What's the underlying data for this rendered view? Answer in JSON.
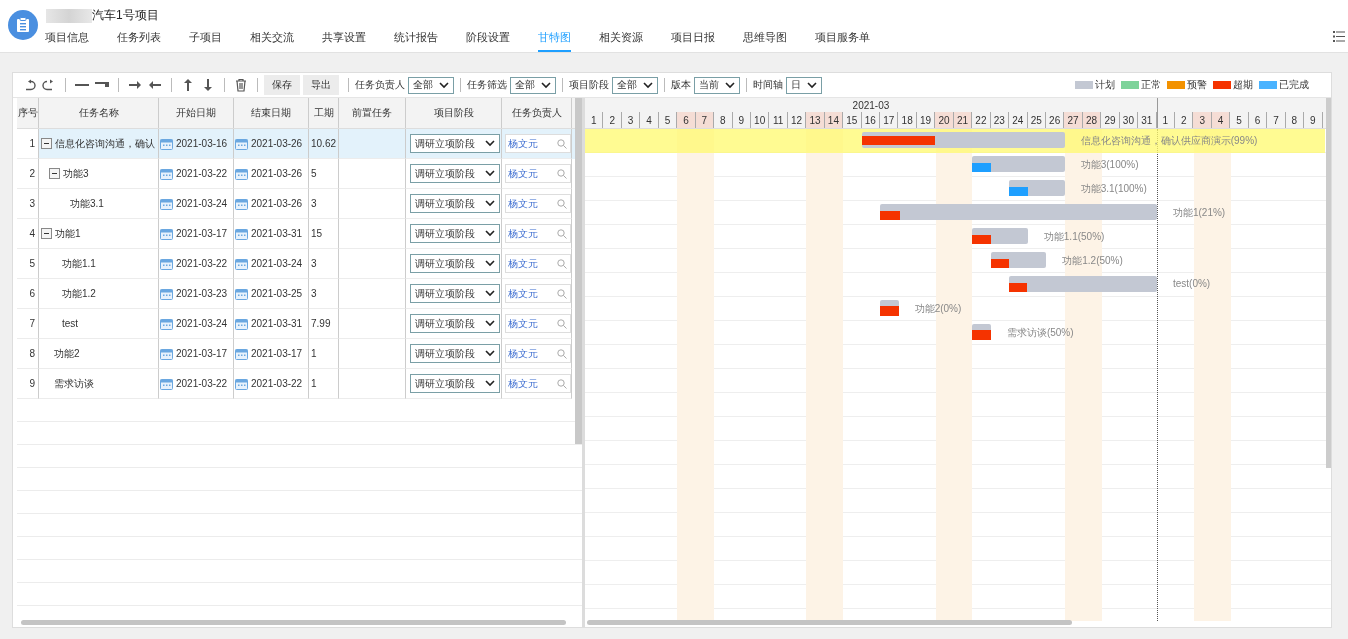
{
  "project": {
    "title": "汽车1号项目",
    "title_blurred": true
  },
  "tabs": [
    {
      "label": "项目信息",
      "selected": false
    },
    {
      "label": "任务列表",
      "selected": false
    },
    {
      "label": "子项目",
      "selected": false
    },
    {
      "label": "相关交流",
      "selected": false
    },
    {
      "label": "共享设置",
      "selected": false
    },
    {
      "label": "统计报告",
      "selected": false
    },
    {
      "label": "阶段设置",
      "selected": false
    },
    {
      "label": "甘特图",
      "selected": true
    },
    {
      "label": "相关资源",
      "selected": false
    },
    {
      "label": "项目日报",
      "selected": false
    },
    {
      "label": "思维导图",
      "selected": false
    },
    {
      "label": "项目服务单",
      "selected": false
    }
  ],
  "toolbar": {
    "tools": [
      {
        "kind": "undo"
      },
      {
        "kind": "redo"
      },
      {
        "kind": "sep"
      },
      {
        "kind": "outdent"
      },
      {
        "kind": "indent"
      },
      {
        "kind": "sep"
      },
      {
        "kind": "right"
      },
      {
        "kind": "left"
      },
      {
        "kind": "sep"
      },
      {
        "kind": "up"
      },
      {
        "kind": "down"
      },
      {
        "kind": "sep"
      },
      {
        "kind": "trash"
      },
      {
        "kind": "sep"
      }
    ],
    "buttons": [
      "保存",
      "导出"
    ],
    "filters": [
      {
        "label": "任务负责人",
        "value": "全部"
      },
      {
        "label": "任务筛选",
        "value": "全部"
      },
      {
        "label": "项目阶段",
        "value": "全部"
      },
      {
        "label": "版本",
        "value": "当前"
      },
      {
        "label": "时间轴",
        "value": "日"
      }
    ],
    "legend": [
      {
        "label": "计划",
        "color": "#c3c8d3"
      },
      {
        "label": "正常",
        "color": "#7dd39a"
      },
      {
        "label": "预警",
        "color": "#f39200"
      },
      {
        "label": "超期",
        "color": "#f53300"
      },
      {
        "label": "已完成",
        "color": "#4ab3ff"
      }
    ]
  },
  "table": {
    "columns": [
      "序号",
      "任务名称",
      "开始日期",
      "结束日期",
      "工期",
      "前置任务",
      "项目阶段",
      "任务负责人"
    ],
    "tasks": [
      {
        "no": "1",
        "name": "信息化咨询沟通，确认",
        "start": "2021-03-16",
        "end": "2021-03-26",
        "duration": "10.62",
        "stage": "调研立项阶段",
        "owner": "杨文元",
        "selected": true,
        "expanded": true,
        "bar": {
          "label": "信息化咨询沟通，确认供应商演示(99%)",
          "kind": "overdue",
          "level": 0.36
        },
        "children": [
          {
            "no": "2",
            "name": "功能3",
            "start": "2021-03-22",
            "end": "2021-03-26",
            "duration": "5",
            "stage": "调研立项阶段",
            "owner": "杨文元",
            "selected": false,
            "expanded": true,
            "bar": {
              "label": "功能3(100%)",
              "kind": "done",
              "level": 0.2
            },
            "children": [
              {
                "no": "3",
                "name": "功能3.1",
                "start": "2021-03-24",
                "end": "2021-03-26",
                "duration": "3",
                "stage": "调研立项阶段",
                "owner": "杨文元",
                "selected": false,
                "bar": {
                  "label": "功能3.1(100%)",
                  "kind": "done",
                  "level": 0.33
                }
              }
            ]
          }
        ]
      },
      {
        "no": "4",
        "name": "功能1",
        "start": "2021-03-17",
        "end": "2021-03-31",
        "duration": "15",
        "stage": "调研立项阶段",
        "owner": "杨文元",
        "selected": false,
        "expanded": true,
        "bar": {
          "label": "功能1(21%)",
          "kind": "overdue",
          "level": 0.07
        },
        "children": [
          {
            "no": "5",
            "name": "功能1.1",
            "start": "2021-03-22",
            "end": "2021-03-24",
            "duration": "3",
            "stage": "调研立项阶段",
            "owner": "杨文元",
            "selected": false,
            "bar": {
              "label": "功能1.1(50%)",
              "kind": "overdue",
              "level": 0.33
            }
          },
          {
            "no": "6",
            "name": "功能1.2",
            "start": "2021-03-23",
            "end": "2021-03-25",
            "duration": "3",
            "stage": "调研立项阶段",
            "owner": "杨文元",
            "selected": false,
            "bar": {
              "label": "功能1.2(50%)",
              "kind": "overdue",
              "level": 0.33
            }
          },
          {
            "no": "7",
            "name": "test",
            "start": "2021-03-24",
            "end": "2021-03-31",
            "duration": "7.99",
            "stage": "调研立项阶段",
            "owner": "杨文元",
            "selected": false,
            "bar": {
              "label": "test(0%)",
              "kind": "overdue",
              "level": 0.12
            }
          }
        ]
      },
      {
        "no": "8",
        "name": "功能2",
        "start": "2021-03-17",
        "end": "2021-03-17",
        "duration": "1",
        "stage": "调研立项阶段",
        "owner": "杨文元",
        "selected": false,
        "bar": {
          "label": "功能2(0%)",
          "kind": "overdue",
          "level": 1
        }
      },
      {
        "no": "9",
        "name": "需求访谈",
        "start": "2021-03-22",
        "end": "2021-03-22",
        "duration": "1",
        "stage": "调研立项阶段",
        "owner": "杨文元",
        "selected": false,
        "bar": {
          "label": "需求访谈(50%)",
          "kind": "overdue",
          "level": 1
        }
      }
    ]
  },
  "timeline": {
    "months": [
      {
        "label": "2021-03",
        "days": [
          {
            "label": "1",
            "weekend": false
          },
          {
            "label": "2",
            "weekend": false
          },
          {
            "label": "3",
            "weekend": false
          },
          {
            "label": "4",
            "weekend": false
          },
          {
            "label": "5",
            "weekend": false
          },
          {
            "label": "6",
            "weekend": true
          },
          {
            "label": "7",
            "weekend": true
          },
          {
            "label": "8",
            "weekend": false
          },
          {
            "label": "9",
            "weekend": false
          },
          {
            "label": "10",
            "weekend": false
          },
          {
            "label": "11",
            "weekend": false
          },
          {
            "label": "12",
            "weekend": false
          },
          {
            "label": "13",
            "weekend": true
          },
          {
            "label": "14",
            "weekend": true
          },
          {
            "label": "15",
            "weekend": false
          },
          {
            "label": "16",
            "weekend": false
          },
          {
            "label": "17",
            "weekend": false
          },
          {
            "label": "18",
            "weekend": false
          },
          {
            "label": "19",
            "weekend": false
          },
          {
            "label": "20",
            "weekend": true
          },
          {
            "label": "21",
            "weekend": true
          },
          {
            "label": "22",
            "weekend": false
          },
          {
            "label": "23",
            "weekend": false
          },
          {
            "label": "24",
            "weekend": false
          },
          {
            "label": "25",
            "weekend": false
          },
          {
            "label": "26",
            "weekend": false
          },
          {
            "label": "27",
            "weekend": true
          },
          {
            "label": "28",
            "weekend": true
          },
          {
            "label": "29",
            "weekend": false
          },
          {
            "label": "30",
            "weekend": false
          },
          {
            "label": "31",
            "weekend": false
          }
        ]
      },
      {
        "days": [
          {
            "label": "1",
            "weekend": false
          },
          {
            "label": "2",
            "weekend": false
          },
          {
            "label": "3",
            "weekend": true
          },
          {
            "label": "4",
            "weekend": true
          },
          {
            "label": "5",
            "weekend": false
          },
          {
            "label": "6",
            "weekend": false
          },
          {
            "label": "7",
            "weekend": false
          },
          {
            "label": "8",
            "weekend": false
          },
          {
            "label": "9",
            "weekend": false
          }
        ]
      }
    ]
  }
}
